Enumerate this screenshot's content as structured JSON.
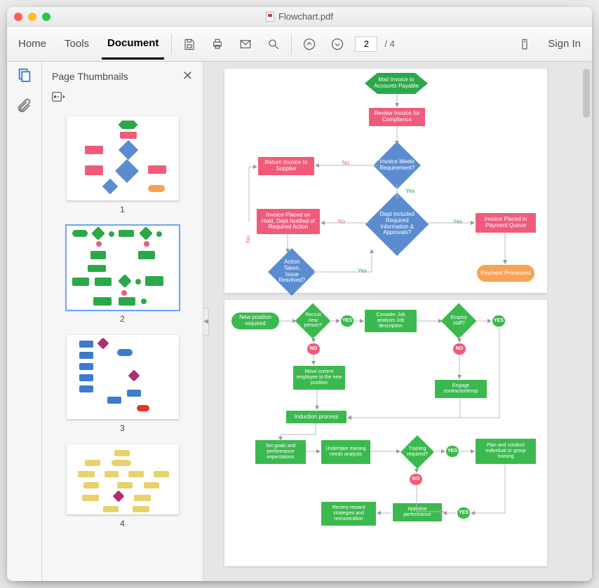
{
  "window": {
    "title": "Flowchart.pdf"
  },
  "toolbar": {
    "home": "Home",
    "tools": "Tools",
    "document": "Document",
    "current_page": "2",
    "total_pages": "/ 4",
    "sign_in": "Sign In"
  },
  "thumb_panel": {
    "title": "Page Thumbnails",
    "pages": {
      "p1": "1",
      "p2": "2",
      "p3": "3",
      "p4": "4"
    }
  },
  "doc1": {
    "mail_invoice": "Mail Invoice to Accounts Payable",
    "review_invoice": "Review Invoice for Compliance",
    "return_supplier": "Return Invoice to Supplier",
    "meets_req": "Invoice Meets Requirement?",
    "placed_hold": "Invoice Placed on Hold, Dept Notified of Required Action",
    "dept_info": "Dept Included Required Information & Approvals?",
    "placed_queue": "Invoice Placed in Payment Queue",
    "action_taken": "Action Taken, Issue Resolved?",
    "payment": "Payment Processed",
    "no_lbl1": "No",
    "yes_lbl1": "Yes",
    "no_lbl2": "No",
    "yes_lbl2": "Yes",
    "no_lbl3": "No",
    "yes_lbl3": "Yes"
  },
  "doc2": {
    "new_position": "New position required",
    "recruit": "Recruit new person?",
    "consider": "Consider Job analysis Job description",
    "employ": "Employ staff?",
    "move_emp": "Move current employee to the new position",
    "engage": "Engage contractor/temp",
    "induction": "Induction process",
    "set_goals": "Set goals and performance expectations",
    "undertake": "Undertake training needs analysis",
    "training": "Training required?",
    "plan_conduct": "Plan and conduct individual or group training",
    "review_reward": "Review reward strategies and remuneration",
    "appraise": "Appraise performance",
    "yes_p1": "YES",
    "no_p1": "NO",
    "yes_p2": "YES",
    "no_p2": "NO",
    "yes_p3": "YES",
    "no_p3": "NO",
    "yes_p4": "YES"
  }
}
